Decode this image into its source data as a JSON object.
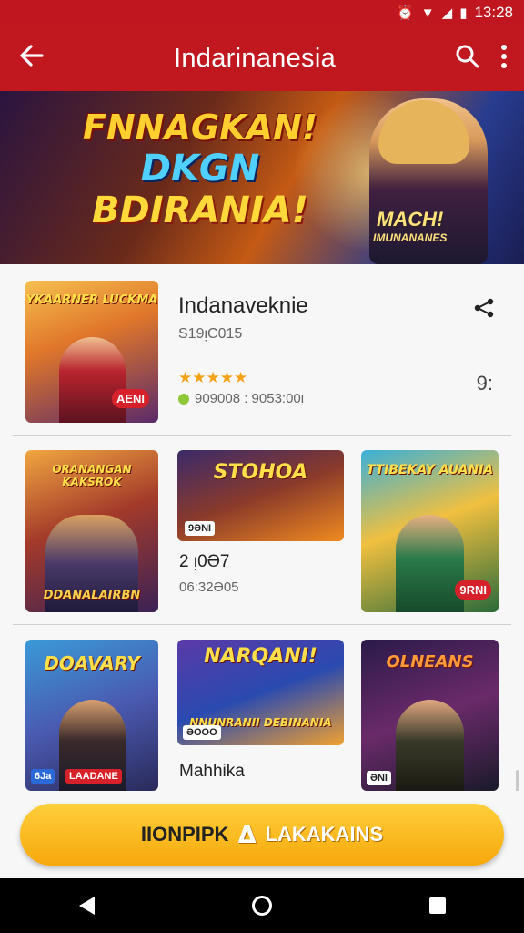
{
  "status": {
    "time": "13:28"
  },
  "app_bar": {
    "title": "Indarinanesia"
  },
  "banner": {
    "line1": "FNNAGKAN!",
    "line2": "DKGN",
    "line3": "BDIRANIA!",
    "tag1": "MACH!",
    "tag2": "IMUNANANES"
  },
  "featured": {
    "title": "Indanaveknie",
    "subtitle": "S19ᴉC015",
    "thumb_label": "YKAARNER LUCKMA",
    "badge": "AENI",
    "stars": "★★★★★",
    "meta": "909008 : 9053:00ᴉ",
    "count": "9:"
  },
  "row1": {
    "c1_label": "ORANANGAN KAKSROK",
    "c1_footer": "DDANALAIRBN",
    "c2_label": "STOHOA",
    "c2_badge": "9ƏNI",
    "c2_title": "2 ᴉ0Ə7",
    "c2_sub": "06:32Ə05",
    "c3_label": "TTIBEKAY AUANIA",
    "c3_badge": "9RNI"
  },
  "row2": {
    "c1_label": "DOAVARY",
    "c1_badge1": "6Ja",
    "c1_badge2": "LAADANE",
    "c2_label": "NARQANI!",
    "c2_banner": "NNUNRANII DEBINANIA",
    "c2_badge": "ƏOOO",
    "c2_title": "Mahhika",
    "c3_label": "OLNEANS",
    "c3_badge": "ƏNI"
  },
  "cta": {
    "left": "IIONPIPK",
    "right": "LAKAKAINS"
  }
}
